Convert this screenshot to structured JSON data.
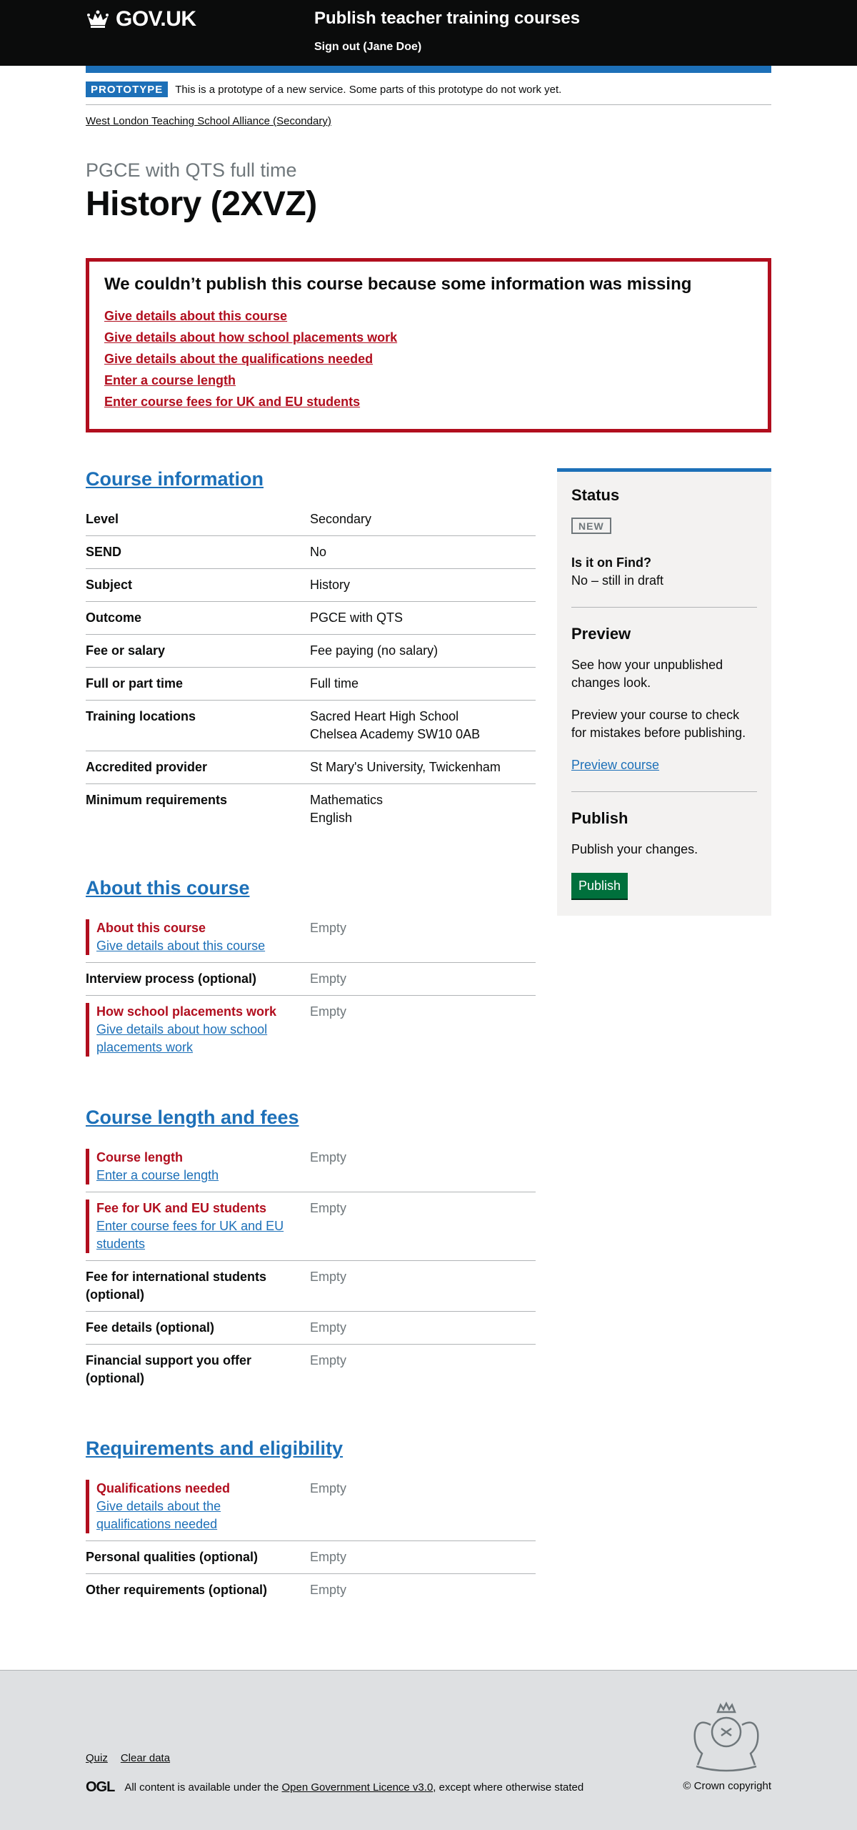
{
  "header": {
    "logo_text": "GOV.UK",
    "service_name": "Publish teacher training courses",
    "signout_label": "Sign out (Jane Doe)"
  },
  "phase": {
    "tag": "PROTOTYPE",
    "text": "This is a prototype of a new service. Some parts of this prototype do not work yet."
  },
  "breadcrumb": "West London Teaching School Alliance (Secondary)",
  "caption": "PGCE with QTS full time",
  "title": "History (2XVZ)",
  "error_summary": {
    "title": "We couldn’t publish this course because some information was missing",
    "links": [
      "Give details about this course",
      "Give details about how school placements work",
      "Give details about the qualifications needed",
      "Enter a course length",
      "Enter course fees for UK and EU students"
    ]
  },
  "course_information": {
    "heading": "Course information",
    "rows": [
      {
        "key": "Level",
        "value": [
          "Secondary"
        ]
      },
      {
        "key": "SEND",
        "value": [
          "No"
        ]
      },
      {
        "key": "Subject",
        "value": [
          "History"
        ]
      },
      {
        "key": "Outcome",
        "value": [
          "PGCE with QTS"
        ]
      },
      {
        "key": "Fee or salary",
        "value": [
          "Fee paying (no salary)"
        ]
      },
      {
        "key": "Full or part time",
        "value": [
          "Full time"
        ]
      },
      {
        "key": "Training locations",
        "value": [
          "Sacred Heart High School",
          "Chelsea Academy SW10 0AB"
        ]
      },
      {
        "key": "Accredited provider",
        "value": [
          "St Mary's University, Twickenham"
        ]
      },
      {
        "key": "Minimum requirements",
        "value": [
          "Mathematics",
          "English"
        ]
      }
    ]
  },
  "about": {
    "heading": "About this course",
    "rows": [
      {
        "key": "About this course",
        "error_link": "Give details about this course",
        "value": "Empty"
      },
      {
        "key": "Interview process (optional)",
        "value": "Empty"
      },
      {
        "key": "How school placements work",
        "error_link": "Give details about how school placements work",
        "value": "Empty"
      }
    ]
  },
  "length_fees": {
    "heading": "Course length and fees",
    "rows": [
      {
        "key": "Course length",
        "error_link": "Enter a course length",
        "value": "Empty"
      },
      {
        "key": "Fee for UK and EU students",
        "error_link": "Enter course fees for UK and EU students",
        "value": "Empty"
      },
      {
        "key": "Fee for international students (optional)",
        "value": "Empty"
      },
      {
        "key": "Fee details (optional)",
        "value": "Empty"
      },
      {
        "key": "Financial support you offer (optional)",
        "value": "Empty"
      }
    ]
  },
  "requirements": {
    "heading": "Requirements and eligibility",
    "rows": [
      {
        "key": "Qualifications needed",
        "error_link": "Give details about the qualifications needed",
        "value": "Empty"
      },
      {
        "key": "Personal qualities (optional)",
        "value": "Empty"
      },
      {
        "key": "Other requirements (optional)",
        "value": "Empty"
      }
    ]
  },
  "sidebar": {
    "status_heading": "Status",
    "status_tag": "NEW",
    "find_question": "Is it on Find?",
    "find_answer": "No – still in draft",
    "preview_heading": "Preview",
    "preview_text_1": "See how your unpublished changes look.",
    "preview_text_2": "Preview your course to check for mistakes before publishing.",
    "preview_link": "Preview course",
    "publish_heading": "Publish",
    "publish_text": "Publish your changes.",
    "publish_button": "Publish"
  },
  "footer": {
    "links": [
      "Quiz",
      "Clear data"
    ],
    "ogl": "OGL",
    "licence_prefix": "All content is available under the",
    "licence_link": "Open Government Licence v3.0",
    "licence_suffix": ", except where otherwise stated",
    "copyright": "© Crown copyright"
  },
  "colors": {
    "brand_blue": "#1d70b8",
    "error_red": "#b10e1e",
    "publish_green": "#00703c",
    "header_black": "#0b0c0c"
  }
}
